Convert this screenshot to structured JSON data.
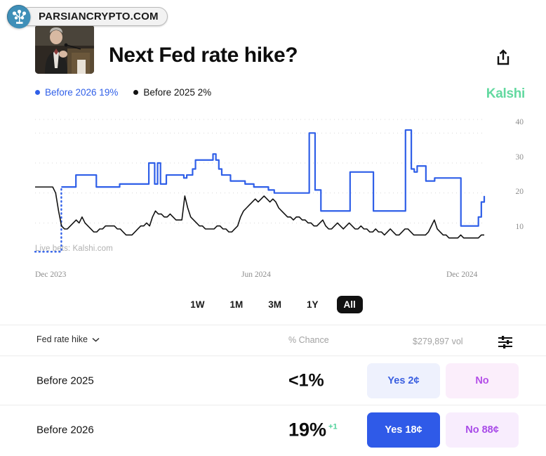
{
  "watermark": {
    "text": "PARSIANCRYPTO.COM",
    "logo_icon": "tree-logo-icon"
  },
  "header": {
    "title": "Next Fed rate hike?",
    "thumbnail_alt": "fed-chair-podium-photo",
    "share_icon": "share-icon"
  },
  "legend": {
    "items": [
      {
        "label": "Before 2026 19%",
        "color": "#2f5fe8",
        "dot": "legend-dot-blue"
      },
      {
        "label": "Before 2025 2%",
        "color": "#121212",
        "dot": "legend-dot-black"
      }
    ],
    "brand": "Kalshi",
    "brand_color": "#63d9a0"
  },
  "chart_data": {
    "type": "line",
    "title": "Next Fed rate hike?",
    "xlabel": "",
    "ylabel": "% Chance",
    "ylim": [
      0,
      45
    ],
    "yticks": [
      10,
      20,
      30,
      40
    ],
    "xticks": [
      "Dec 2023",
      "Jun 2024",
      "Dec 2024"
    ],
    "grid": true,
    "legend_position": "top-left",
    "watermark": "Live bets: Kalshi.com",
    "series": [
      {
        "name": "Before 2026",
        "color": "#2f5fe8",
        "style": "step",
        "dashed_prefix_points": 9,
        "values": [
          0.4,
          0.4,
          0.4,
          0.4,
          0.4,
          0.4,
          0.4,
          0.4,
          0.4,
          22,
          22,
          22,
          22,
          22,
          26,
          26,
          26,
          26,
          26,
          26,
          26,
          22,
          22,
          22,
          22,
          22,
          22,
          22,
          22,
          23,
          23,
          23,
          23,
          23,
          23,
          23,
          23,
          23,
          23,
          30,
          30,
          23,
          30,
          23,
          23,
          26,
          26,
          26,
          26,
          26,
          26,
          25,
          26,
          26,
          28,
          31,
          31,
          31,
          31,
          31,
          31,
          33,
          31,
          28,
          26,
          26,
          26,
          24,
          24,
          24,
          24,
          24,
          23,
          23,
          23,
          22,
          22,
          22,
          22,
          22,
          21,
          21,
          20,
          20,
          20,
          20,
          20,
          20,
          20,
          20,
          20,
          20,
          20,
          20,
          40,
          40,
          21,
          21,
          14,
          14,
          14,
          14,
          14,
          14,
          14,
          14,
          14,
          14,
          27,
          27,
          27,
          27,
          27,
          27,
          27,
          27,
          14,
          14,
          14,
          14,
          14,
          14,
          14,
          14,
          14,
          14,
          14,
          41,
          41,
          28,
          27,
          29,
          29,
          29,
          24,
          24,
          24,
          25,
          25,
          25,
          25,
          25,
          25,
          25,
          25,
          25,
          9,
          9,
          9,
          9,
          9,
          9,
          12,
          17,
          19
        ]
      },
      {
        "name": "Before 2025",
        "color": "#111111",
        "style": "line",
        "values": [
          22,
          22,
          22,
          22,
          22,
          22,
          22,
          20,
          14,
          9,
          8,
          8,
          9,
          10,
          11,
          10,
          12,
          10,
          9,
          8,
          7,
          7,
          8,
          8,
          9,
          9,
          9,
          9,
          8,
          8,
          7,
          6,
          6,
          6,
          7,
          8,
          9,
          9,
          10,
          9,
          12,
          14,
          13,
          13,
          12,
          12,
          13,
          12,
          11,
          11,
          11,
          19,
          15,
          12,
          11,
          10,
          9,
          9,
          8,
          8,
          8,
          8,
          9,
          9,
          8,
          8,
          7,
          7,
          8,
          9,
          12,
          14,
          15,
          16,
          17,
          18,
          17,
          18,
          19,
          18,
          17,
          18,
          17,
          15,
          14,
          13,
          12,
          12,
          11,
          12,
          12,
          11,
          11,
          10,
          10,
          9,
          9,
          10,
          11,
          9,
          8,
          8,
          9,
          10,
          9,
          8,
          9,
          10,
          9,
          8,
          8,
          9,
          8,
          8,
          7,
          7,
          8,
          7,
          7,
          6,
          7,
          8,
          7,
          6,
          6,
          7,
          8,
          8,
          7,
          6,
          6,
          6,
          6,
          6,
          7,
          9,
          11,
          8,
          7,
          6,
          6,
          5,
          5,
          5,
          5,
          6,
          5,
          5,
          5,
          5,
          5,
          5,
          6,
          6
        ]
      }
    ]
  },
  "time_ranges": {
    "options": [
      "1W",
      "1M",
      "3M",
      "1Y",
      "All"
    ],
    "selected": "All"
  },
  "filter_row": {
    "dropdown_label": "Fed rate hike",
    "dropdown_icon": "chevron-down-icon",
    "chance_header": "% Chance",
    "volume": "$279,897 vol",
    "settings_icon": "sliders-icon"
  },
  "markets": [
    {
      "name": "Before 2025",
      "percent": "<1%",
      "delta": "",
      "yes_label": "Yes 2¢",
      "no_label": "No",
      "yes_style": "soft",
      "no_style": "soft"
    },
    {
      "name": "Before 2026",
      "percent": "19%",
      "delta": "+1",
      "yes_label": "Yes 18¢",
      "no_label": "No 88¢",
      "yes_style": "solid",
      "no_style": "soft"
    }
  ]
}
